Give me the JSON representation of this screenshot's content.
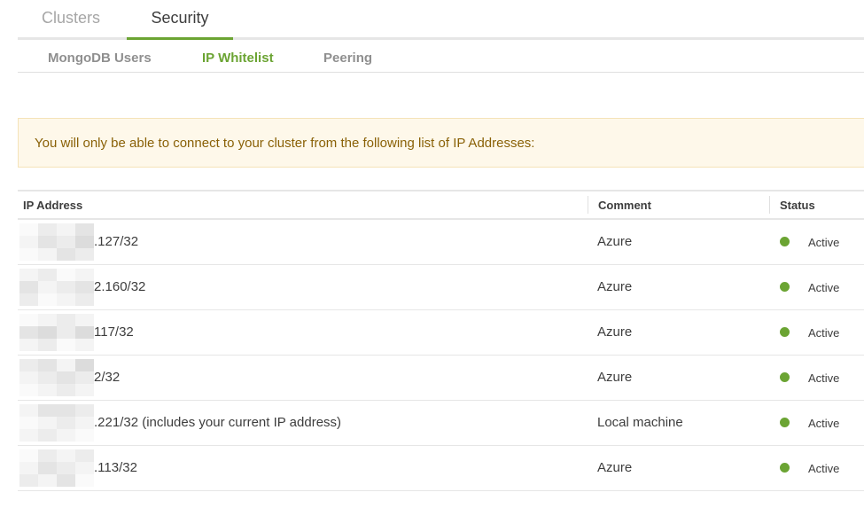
{
  "top_tabs": [
    {
      "label": "Clusters"
    },
    {
      "label": "Security"
    }
  ],
  "sub_tabs": [
    {
      "label": "MongoDB Users"
    },
    {
      "label": "IP Whitelist"
    },
    {
      "label": "Peering"
    }
  ],
  "notice": {
    "text": "You will only be able to connect to your cluster from the following list of IP Addresses:"
  },
  "table": {
    "columns": [
      "IP Address",
      "Comment",
      "Status"
    ],
    "rows": [
      {
        "ip": ".127/32",
        "comment": "Azure",
        "status": "Active"
      },
      {
        "ip": "2.160/32",
        "comment": "Azure",
        "status": "Active"
      },
      {
        "ip": "117/32",
        "comment": "Azure",
        "status": "Active"
      },
      {
        "ip": "2/32",
        "comment": "Azure",
        "status": "Active"
      },
      {
        "ip": ".221/32 (includes your current IP address)",
        "comment": "Local machine",
        "status": "Active"
      },
      {
        "ip": ".113/32",
        "comment": "Azure",
        "status": "Active"
      }
    ]
  },
  "colors": {
    "accent": "#6ba433",
    "status_active": "#6ba433",
    "notice_bg": "#fef8ea",
    "notice_text": "#8a6107"
  }
}
